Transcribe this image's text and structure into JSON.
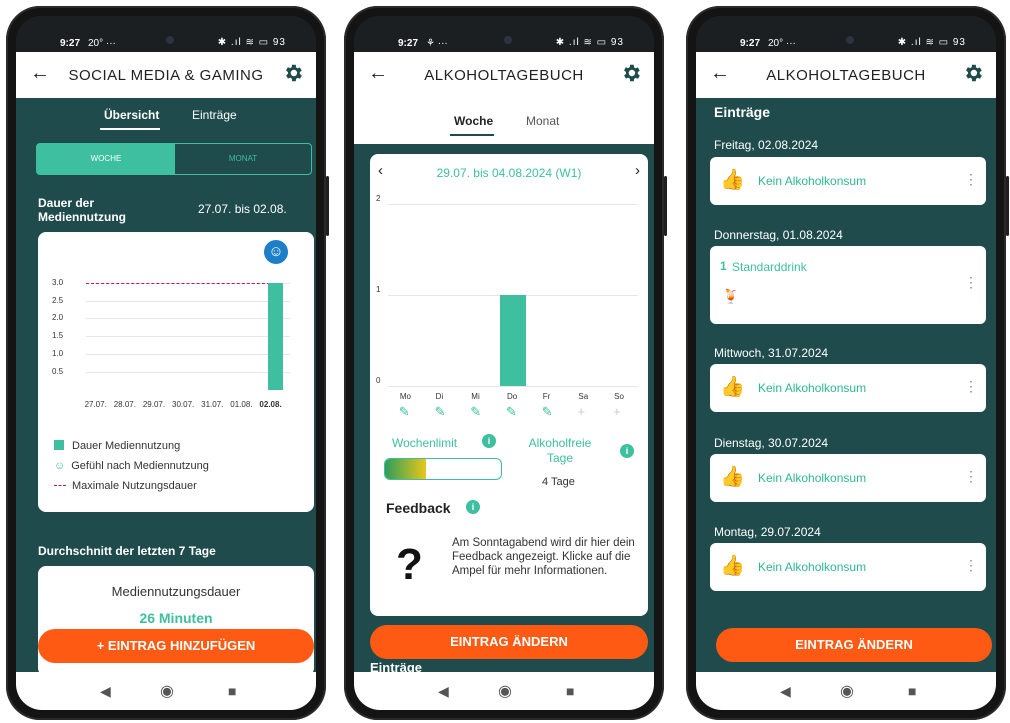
{
  "colors": {
    "accent": "#3dbfa0",
    "dark_bg": "#1f4b4c",
    "fab": "#ff5a14"
  },
  "phone1": {
    "status": {
      "time": "9:27",
      "extra": "20° ···",
      "right": "✱ .ıl ≋ ▭ 93"
    },
    "title": "SOCIAL MEDIA & GAMING",
    "tabs": [
      "Übersicht",
      "Einträge"
    ],
    "toggle": [
      "WOCHE",
      "MONAT"
    ],
    "section_title": "Dauer der Mediennutzung",
    "date_range": "27.07. bis 02.08.",
    "chart_data": {
      "type": "bar",
      "categories": [
        "27.07.",
        "28.07.",
        "29.07.",
        "30.07.",
        "31.07.",
        "01.08.",
        "02.08."
      ],
      "values": [
        0,
        0,
        0,
        0,
        0,
        0,
        3.0
      ],
      "yticks": [
        "3.0",
        "2.5",
        "2.0",
        "1.5",
        "1.0",
        "0.5"
      ],
      "ylim": [
        0,
        3.3
      ],
      "max_line": 3.0
    },
    "legend": [
      "Dauer Mediennutzung",
      "Gefühl nach Mediennutzung",
      "Maximale Nutzungsdauer"
    ],
    "avg_title": "Durchschnitt der letzten 7 Tage",
    "avg_label": "Mediennutzungsdauer",
    "avg_value": "26 Minuten",
    "fab": "+ EINTRAG HINZUFÜGEN"
  },
  "phone2": {
    "status": {
      "time": "9:27",
      "extra": "⚘ ···",
      "right": "✱ .ıl ≋ ▭ 93"
    },
    "title": "ALKOHOLTAGEBUCH",
    "tabs": [
      "Woche",
      "Monat"
    ],
    "week_label": "29.07. bis 04.08.2024 (W1)",
    "chart_data": {
      "type": "bar",
      "categories": [
        "Mo",
        "Di",
        "Mi",
        "Do",
        "Fr",
        "Sa",
        "So"
      ],
      "values": [
        0,
        0,
        0,
        1,
        0,
        0,
        0
      ],
      "yticks": [
        "2",
        "1",
        "0"
      ],
      "ylim": [
        0,
        2
      ]
    },
    "edit_icons": [
      "pencil-icon",
      "pencil-icon",
      "pencil-icon",
      "pencil-icon",
      "pencil-icon",
      "plus-icon",
      "plus-icon"
    ],
    "weekly_limit": "Wochenlimit",
    "weekly_limit_progress": 0.35,
    "alcohol_free_label": "Alkoholfreie Tage",
    "alcohol_free_value": "4 Tage",
    "feedback_title": "Feedback",
    "feedback_text": "Am Sonntagabend wird dir hier dein Feedback angezeigt. Klicke auf die Ampel für mehr Informationen.",
    "fab": "EINTRAG ÄNDERN",
    "entries_heading": "Einträge"
  },
  "phone3": {
    "status": {
      "time": "9:27",
      "extra": "20° ···",
      "right": "✱ .ıl ≋ ▭ 93"
    },
    "title": "ALKOHOLTAGEBUCH",
    "heading": "Einträge",
    "entries": [
      {
        "date": "Freitag, 02.08.2024",
        "text": "Kein Alkoholkonsum"
      },
      {
        "date": "Donnerstag, 01.08.2024",
        "count": "1",
        "text": "Standarddrink"
      },
      {
        "date": "Mittwoch, 31.07.2024",
        "text": "Kein Alkoholkonsum"
      },
      {
        "date": "Dienstag, 30.07.2024",
        "text": "Kein Alkoholkonsum"
      },
      {
        "date": "Montag, 29.07.2024",
        "text": "Kein Alkoholkonsum"
      }
    ],
    "fab": "EINTRAG ÄNDERN"
  }
}
